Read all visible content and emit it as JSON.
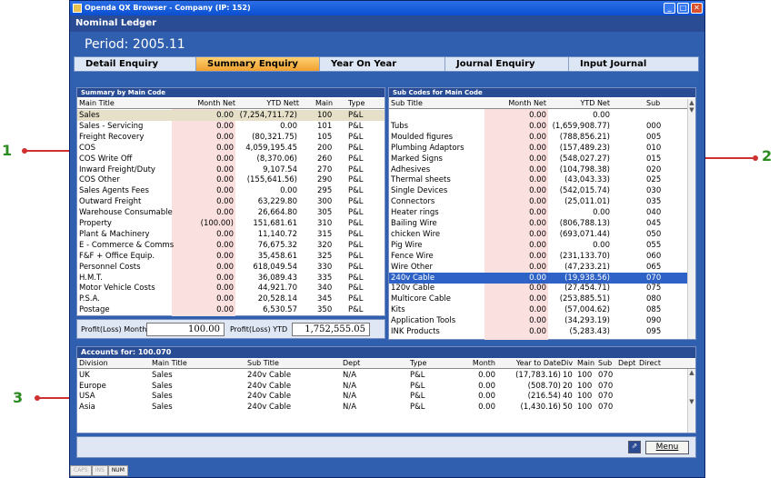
{
  "window": {
    "title": "Openda QX Browser - Company (IP: 152)"
  },
  "header": {
    "title": "Nominal Ledger"
  },
  "period": "Period: 2005.11",
  "tabs": [
    {
      "label": "Detail Enquiry"
    },
    {
      "label": "Summary Enquiry"
    },
    {
      "label": "Year On Year"
    },
    {
      "label": "Journal Enquiry"
    },
    {
      "label": "Input Journal"
    }
  ],
  "left_panel": {
    "title": "Summary by Main Code",
    "headers": [
      "Main Title",
      "Month Net",
      "YTD Nett",
      "Main",
      "Type"
    ],
    "rows": [
      [
        "Sales",
        "0.00",
        "(7,254,711.72)",
        "100",
        "P&L"
      ],
      [
        "Sales - Servicing",
        "0.00",
        "0.00",
        "101",
        "P&L"
      ],
      [
        "Freight Recovery",
        "0.00",
        "(80,321.75)",
        "105",
        "P&L"
      ],
      [
        "COS",
        "0.00",
        "4,059,195.45",
        "200",
        "P&L"
      ],
      [
        "COS Write Off",
        "0.00",
        "(8,370.06)",
        "260",
        "P&L"
      ],
      [
        "Inward Freight/Duty",
        "0.00",
        "9,107.54",
        "270",
        "P&L"
      ],
      [
        "COS Other",
        "0.00",
        "(155,641.56)",
        "290",
        "P&L"
      ],
      [
        "Sales Agents Fees",
        "0.00",
        "0.00",
        "295",
        "P&L"
      ],
      [
        "Outward Freight",
        "0.00",
        "63,229.80",
        "300",
        "P&L"
      ],
      [
        "Warehouse Consumable",
        "0.00",
        "26,664.80",
        "305",
        "P&L"
      ],
      [
        "Property",
        "(100.00)",
        "151,681.61",
        "310",
        "P&L"
      ],
      [
        "Plant & Machinery",
        "0.00",
        "11,140.72",
        "315",
        "P&L"
      ],
      [
        "E - Commerce & Comms",
        "0.00",
        "76,675.32",
        "320",
        "P&L"
      ],
      [
        "F&F + Office Equip.",
        "0.00",
        "35,458.61",
        "325",
        "P&L"
      ],
      [
        "Personnel Costs",
        "0.00",
        "618,049.54",
        "330",
        "P&L"
      ],
      [
        "H.M.T.",
        "0.00",
        "36,089.43",
        "335",
        "P&L"
      ],
      [
        "Motor Vehicle Costs",
        "0.00",
        "44,921.70",
        "340",
        "P&L"
      ],
      [
        "P.S.A.",
        "0.00",
        "20,528.14",
        "345",
        "P&L"
      ],
      [
        "Postage",
        "0.00",
        "6,530.57",
        "350",
        "P&L"
      ]
    ],
    "pl_month_label": "Profit(Loss) Month",
    "pl_month_value": "100.00",
    "pl_ytd_label": "Profit(Loss) YTD",
    "pl_ytd_value": "1,752,555.05"
  },
  "right_panel": {
    "title": "Sub Codes for Main Code",
    "headers": [
      "Sub Title",
      "Month Net",
      "YTD Net",
      "Sub"
    ],
    "rows": [
      [
        "",
        "0.00",
        "0.00",
        ""
      ],
      [
        "Tubs",
        "0.00",
        "(1,659,908.77)",
        "000"
      ],
      [
        "Moulded figures",
        "0.00",
        "(788,856.21)",
        "005"
      ],
      [
        "Plumbing Adaptors",
        "0.00",
        "(157,489.23)",
        "010"
      ],
      [
        "Marked Signs",
        "0.00",
        "(548,027.27)",
        "015"
      ],
      [
        "Adhesives",
        "0.00",
        "(104,798.38)",
        "020"
      ],
      [
        "Thermal sheets",
        "0.00",
        "(43,043.33)",
        "025"
      ],
      [
        "Single Devices",
        "0.00",
        "(542,015.74)",
        "030"
      ],
      [
        "Connectors",
        "0.00",
        "(25,011.01)",
        "035"
      ],
      [
        "Heater rings",
        "0.00",
        "0.00",
        "040"
      ],
      [
        "Bailing Wire",
        "0.00",
        "(806,788.13)",
        "045"
      ],
      [
        "chicken Wire",
        "0.00",
        "(693,071.44)",
        "050"
      ],
      [
        "Pig Wire",
        "0.00",
        "0.00",
        "055"
      ],
      [
        "Fence Wire",
        "0.00",
        "(231,133.70)",
        "060"
      ],
      [
        "Wire Other",
        "0.00",
        "(47,233.21)",
        "065"
      ],
      [
        "240v Cable",
        "0.00",
        "(19,938.56)",
        "070"
      ],
      [
        "120v Cable",
        "0.00",
        "(27,454.71)",
        "075"
      ],
      [
        "Multicore Cable",
        "0.00",
        "(253,885.51)",
        "080"
      ],
      [
        "Kits",
        "0.00",
        "(57,004.62)",
        "085"
      ],
      [
        "Application Tools",
        "0.00",
        "(34,293.19)",
        "090"
      ],
      [
        "INK Products",
        "0.00",
        "(5,283.43)",
        "095"
      ]
    ]
  },
  "accounts_panel": {
    "title": "Accounts for: 100.070",
    "headers": [
      "Division",
      "Main Title",
      "Sub Title",
      "Dept",
      "Type",
      "Month",
      "Year to Date",
      "Div",
      "Main",
      "Sub",
      "Dept",
      "Direct"
    ],
    "rows": [
      [
        "UK",
        "Sales",
        "240v Cable",
        "N/A",
        "P&L",
        "0.00",
        "(17,783.16)",
        "10",
        "100",
        "070"
      ],
      [
        "Europe",
        "Sales",
        "240v Cable",
        "N/A",
        "P&L",
        "0.00",
        "(508.70)",
        "20",
        "100",
        "070"
      ],
      [
        "USA",
        "Sales",
        "240v Cable",
        "N/A",
        "P&L",
        "0.00",
        "(216.54)",
        "40",
        "100",
        "070"
      ],
      [
        "Asia",
        "Sales",
        "240v Cable",
        "N/A",
        "P&L",
        "0.00",
        "(1,430.16)",
        "50",
        "100",
        "070"
      ]
    ]
  },
  "footer": {
    "menu_label": "Menu"
  },
  "status": [
    "CAPS",
    "INS",
    "NUM"
  ],
  "annotations": [
    "1",
    "2",
    "3"
  ],
  "colors": {
    "accent": "#f0a030",
    "selection": "#2e62c6",
    "window": "#2f5fae",
    "annotation": "#2a8a20",
    "arrow": "#d03030"
  }
}
